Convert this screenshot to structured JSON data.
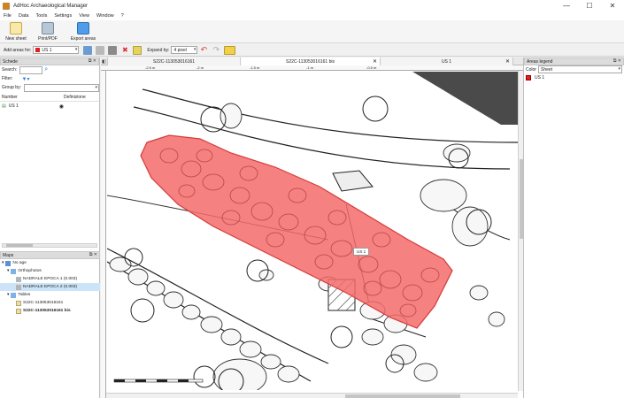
{
  "app": {
    "title": "AdHoc Archaeological Manager"
  },
  "menu": [
    "File",
    "Data",
    "Tools",
    "Settings",
    "View",
    "Window",
    "?"
  ],
  "window_buttons": [
    "—",
    "☐",
    "✕"
  ],
  "toolbar": {
    "new_sheet": "New sheet",
    "print_pdf": "Print/PDF",
    "export_areas": "Export areas"
  },
  "areas_bar": {
    "add_label": "Add areas for:",
    "add_value": "US 1",
    "expand_label": "Expand by:",
    "expand_value": "4 pixel"
  },
  "schede": {
    "title": "Schede",
    "search_label": "Search:",
    "filter_label": "Filter:",
    "group_label": "Group by:",
    "col_number": "Number",
    "col_def": "Definizione",
    "rows": [
      {
        "number": "US 1"
      }
    ]
  },
  "maps": {
    "title": "Maps",
    "root": "No age",
    "orthophotos": "Orthophotos",
    "ortho_items": [
      "NADRALE EPOCA 1 (0.003)",
      "NADRALE EPOCA 2 (0.003)"
    ],
    "tables": "Tables",
    "table_items": [
      "S22C-113053016161",
      "S22C-113053016161 bis"
    ]
  },
  "tabs": [
    {
      "label": "S22C-113053016161"
    },
    {
      "label": "S22C-113053016161 bis"
    },
    {
      "label": "US 1"
    }
  ],
  "ruler_labels": [
    "-2.5 m",
    "-2 m",
    "-1.5 m",
    "-1 m",
    "-0.5 m"
  ],
  "map": {
    "area_label": "US 1",
    "area_color": "#f25c5c"
  },
  "legend": {
    "title": "Areas legend",
    "col_color": "Color",
    "col_sheet": "Sheet",
    "items": [
      {
        "label": "US 1",
        "color": "#e02020"
      }
    ]
  },
  "colors": {
    "accent": "#2f7fd8",
    "area_fill": "#f36b6b",
    "area_stroke": "#d73a3a"
  }
}
